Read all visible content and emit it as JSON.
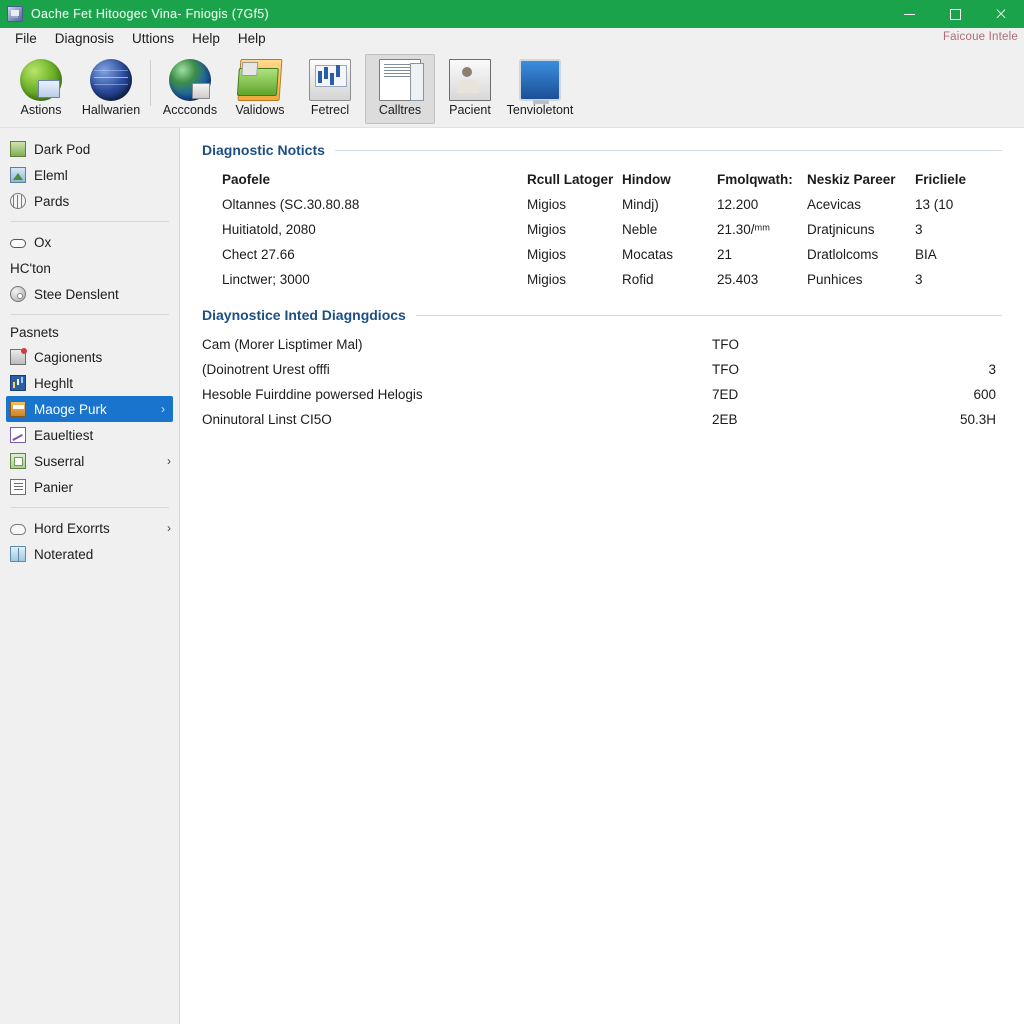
{
  "window": {
    "title": "Oache Fet Hitoogec Vina- Fniogis (7Gf5)",
    "icon": "app-icon",
    "controls": {
      "minimize": "–",
      "maximize": "□",
      "close": "×"
    }
  },
  "menubar": {
    "items": [
      "File",
      "Diagnosis",
      "Uttions",
      "Help",
      "Help"
    ],
    "hint": "Faicoue Intele"
  },
  "toolbar": {
    "buttons": [
      {
        "label": "Astions",
        "icon": "globe-green-icon",
        "selected": false
      },
      {
        "label": "Hallwarien",
        "icon": "globe-blue-icon",
        "selected": false
      },
      {
        "label": "Accconds",
        "icon": "globe-earth-icon",
        "selected": false
      },
      {
        "label": "Validows",
        "icon": "folder-open-icon",
        "selected": false
      },
      {
        "label": "Fetrecl",
        "icon": "monitor-chart-icon",
        "selected": false
      },
      {
        "label": "Calltres",
        "icon": "document-pages-icon",
        "selected": true
      },
      {
        "label": "Pacient",
        "icon": "person-card-icon",
        "selected": false
      },
      {
        "label": "Tenvioletont",
        "icon": "display-icon",
        "selected": false
      }
    ]
  },
  "sidebar": {
    "items": [
      {
        "type": "item",
        "label": "Dark Pod",
        "icon": "image-icon",
        "chevron": false,
        "selected": false
      },
      {
        "type": "item",
        "label": "Eleml",
        "icon": "picture-icon",
        "chevron": false,
        "selected": false
      },
      {
        "type": "item",
        "label": "Pards",
        "icon": "network-icon",
        "chevron": false,
        "selected": false
      },
      {
        "type": "separator"
      },
      {
        "type": "item",
        "label": "Ox",
        "icon": "pill-icon",
        "chevron": false,
        "selected": false
      },
      {
        "type": "plain",
        "label": "HC'ton"
      },
      {
        "type": "item",
        "label": "Stee Denslent",
        "icon": "disc-icon",
        "chevron": false,
        "selected": false
      },
      {
        "type": "separator"
      },
      {
        "type": "group",
        "label": "Pasnets"
      },
      {
        "type": "item",
        "label": "Cagionents",
        "icon": "components-icon",
        "chevron": false,
        "selected": false
      },
      {
        "type": "item",
        "label": "Heghlt",
        "icon": "chart-icon",
        "chevron": false,
        "selected": false
      },
      {
        "type": "item",
        "label": "Maoge Purk",
        "icon": "tool-icon",
        "chevron": true,
        "selected": true
      },
      {
        "type": "item",
        "label": "Eaueltiest",
        "icon": "graph-icon",
        "chevron": false,
        "selected": false
      },
      {
        "type": "item",
        "label": "Suserral",
        "icon": "panel-icon",
        "chevron": true,
        "selected": false
      },
      {
        "type": "item",
        "label": "Panier",
        "icon": "page-icon",
        "chevron": false,
        "selected": false
      },
      {
        "type": "separator"
      },
      {
        "type": "item",
        "label": "Hord Exorrts",
        "icon": "cloud-icon",
        "chevron": true,
        "selected": false
      },
      {
        "type": "item",
        "label": "Noterated",
        "icon": "book-icon",
        "chevron": false,
        "selected": false
      }
    ]
  },
  "content": {
    "notices": {
      "title": "Diagnostic Noticts",
      "columns": [
        "Paofele",
        "Rcull Latoger",
        "Hindow",
        "Fmolqwath:",
        "Neskiz Pareer",
        "Fricliele"
      ],
      "rows": [
        [
          "Oltannes (SC.30.80.88",
          "Migios",
          "Mindj)",
          "12.200",
          "Acevicas",
          "13 (10"
        ],
        [
          "Huitiatold, 2080",
          "Migios",
          "Neble",
          "21.30/ᵐᵐ",
          "Dratjnicuns",
          "3"
        ],
        [
          "Chect 27.66",
          "Migios",
          "Mocatas",
          "21",
          "Dratlolcoms",
          "BIA"
        ],
        [
          "Linctwer; 3000",
          "Migios",
          "Rofid",
          "25.403",
          "Punhices",
          "3"
        ]
      ]
    },
    "listed": {
      "title": "Diaynostice Inted Diagngdiocs",
      "rows": [
        [
          "Cam (Morer Lisptimer Mal)",
          "TFO",
          ""
        ],
        [
          "(Doinotrent Urest offfi",
          "TFO",
          "3"
        ],
        [
          "Hesoble Fuirddine powersed Helogis",
          "7ED",
          "600"
        ],
        [
          "Oninutoral Linst CI5O",
          "2EB",
          "50.3H"
        ]
      ]
    }
  },
  "colors": {
    "titlebar": "#1aa34a",
    "chrome": "#f0f0f0",
    "accent_heading": "#1e4f84",
    "selection": "#1874cd",
    "hint": "#b06a74"
  }
}
